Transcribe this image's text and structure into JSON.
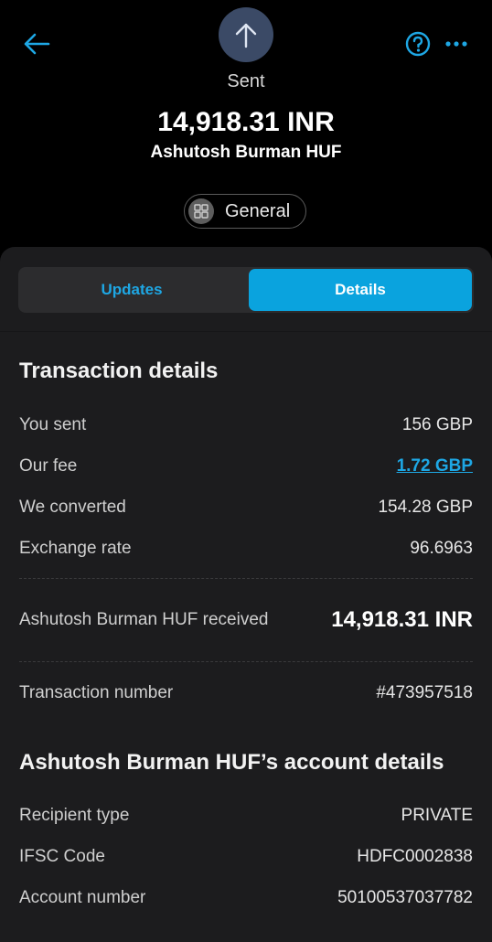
{
  "header": {
    "status": "Sent",
    "amount": "14,918.31 INR",
    "recipient": "Ashutosh Burman HUF",
    "category": "General"
  },
  "tabs": [
    {
      "label": "Updates",
      "active": false
    },
    {
      "label": "Details",
      "active": true
    }
  ],
  "transaction": {
    "title": "Transaction details",
    "rows": [
      {
        "label": "You sent",
        "value": "156 GBP"
      },
      {
        "label": "Our fee",
        "value": "1.72 GBP"
      },
      {
        "label": "We converted",
        "value": "154.28 GBP"
      },
      {
        "label": "Exchange rate",
        "value": "96.6963"
      }
    ],
    "received_label": "Ashutosh Burman HUF received",
    "received_value": "14,918.31 INR",
    "number_label": "Transaction number",
    "number_value": "#473957518"
  },
  "account": {
    "title": "Ashutosh Burman HUF’s account details",
    "rows": [
      {
        "label": "Recipient type",
        "value": "PRIVATE"
      },
      {
        "label": "IFSC Code",
        "value": "HDFC0002838"
      },
      {
        "label": "Account number",
        "value": "50100537037782"
      }
    ]
  },
  "colors": {
    "accent": "#0aa3de",
    "link": "#1ea7e4",
    "background": "#000000",
    "sheet": "#1c1c1e",
    "sent_icon_bg": "#3b4a66"
  },
  "icons": [
    "back-arrow-icon",
    "sent-arrow-icon",
    "help-icon",
    "more-icon",
    "category-grid-icon"
  ]
}
